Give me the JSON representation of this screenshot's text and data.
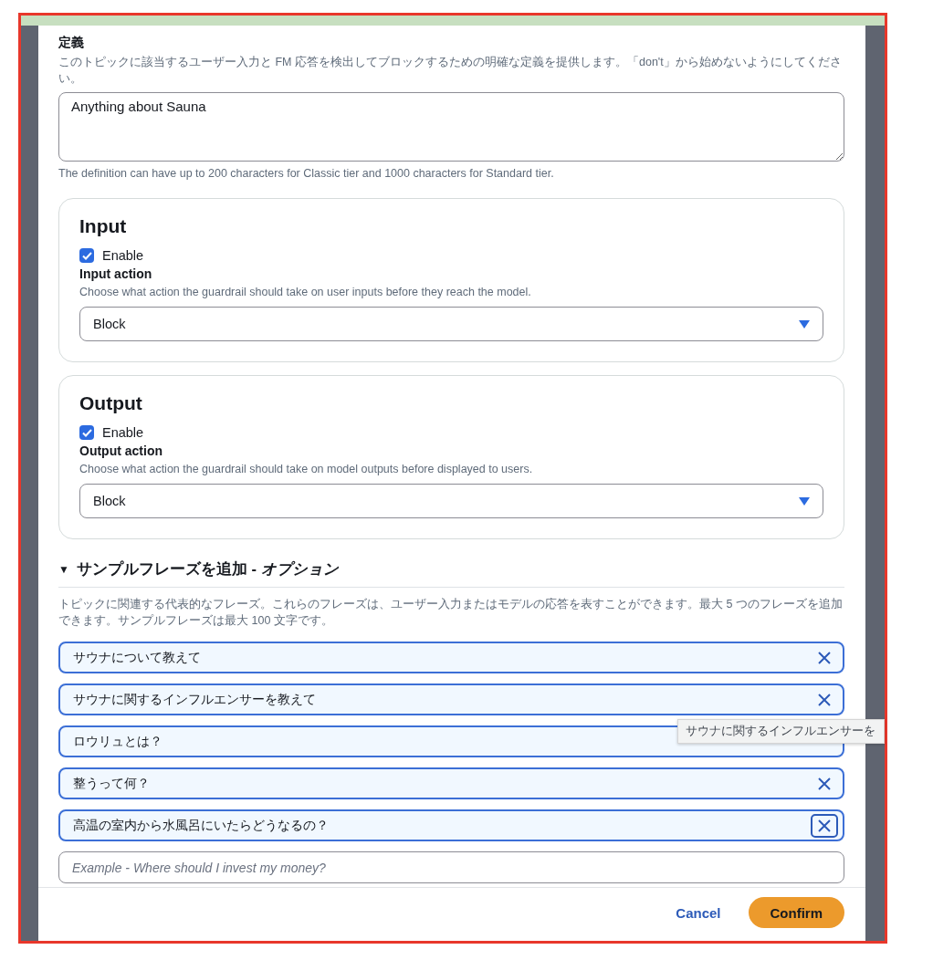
{
  "definition": {
    "label": "定義",
    "description": "このトピックに該当するユーザー入力と FM 応答を検出してブロックするための明確な定義を提供します。「don't」から始めないようにしてください。",
    "value": "Anything about Sauna",
    "hint": "The definition can have up to 200 characters for Classic tier and 1000 characters for Standard tier."
  },
  "cards": [
    {
      "title": "Input",
      "enable_label": "Enable",
      "checked": true,
      "action_label": "Input action",
      "action_description": "Choose what action the guardrail should take on user inputs before they reach the model.",
      "action_value": "Block"
    },
    {
      "title": "Output",
      "enable_label": "Enable",
      "checked": true,
      "action_label": "Output action",
      "action_description": "Choose what action the guardrail should take on model outputs before displayed to users.",
      "action_value": "Block"
    }
  ],
  "sample_phrases": {
    "expanded": true,
    "toggle": "▼",
    "title": "サンプルフレーズを追加 - *オプション*",
    "description": "トピックに関連する代表的なフレーズ。これらのフレーズは、ユーザー入力またはモデルの応答を表すことができます。最大 5 つのフレーズを追加できます。サンプルフレーズは最大 100 文字です。",
    "phrases": [
      {
        "text": "サウナについて教えて",
        "focused": false
      },
      {
        "text": "サウナに関するインフルエンサーを教えて",
        "focused": false
      },
      {
        "text": "ロウリュとは？",
        "remove_covered": true
      },
      {
        "text": "整うって何？",
        "focused": false
      },
      {
        "text": "高温の室内から水風呂にいたらどうなるの？",
        "focused": true
      }
    ],
    "new_phrase_placeholder": "Example - Where should I invest my money?",
    "tooltip": "サウナに関するインフルエンサーを"
  },
  "footer": {
    "cancel": "Cancel",
    "confirm": "Confirm"
  }
}
